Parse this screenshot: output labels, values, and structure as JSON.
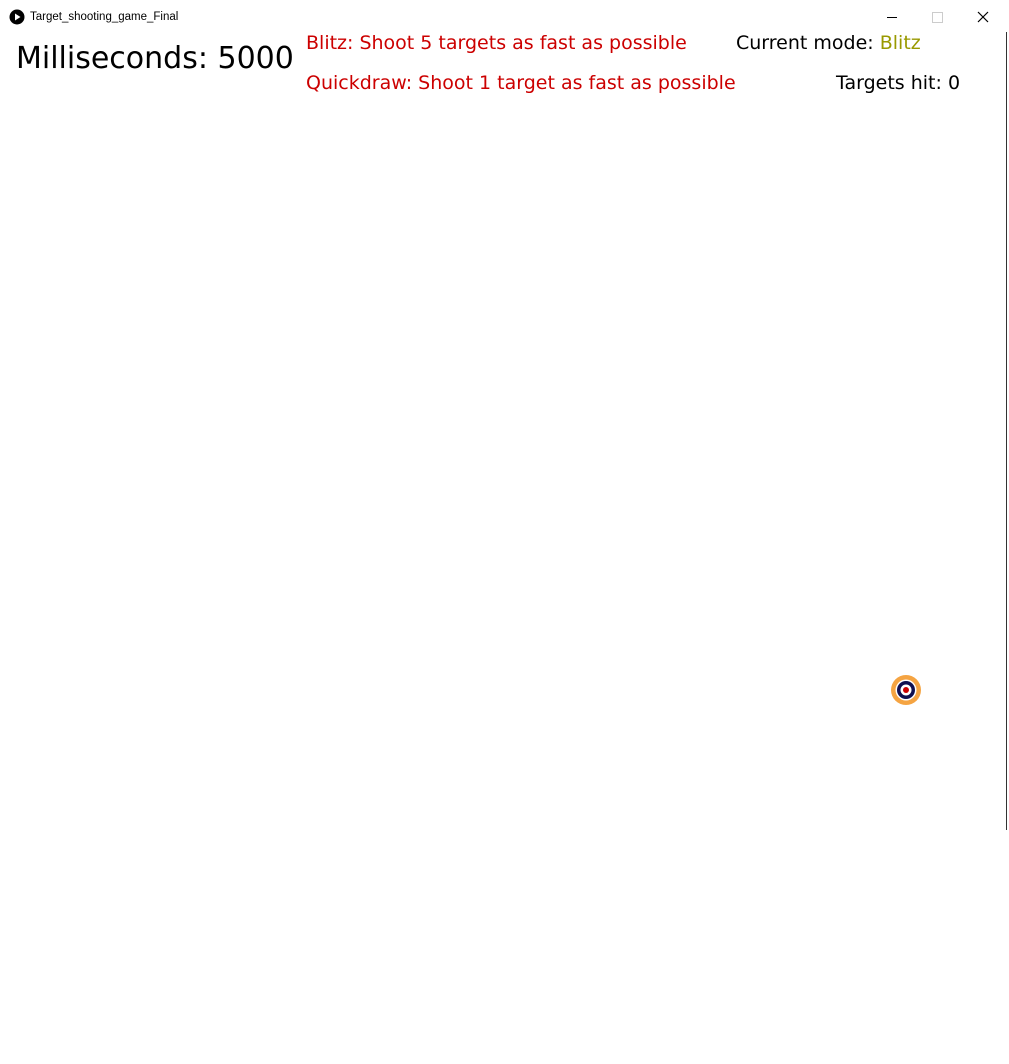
{
  "window": {
    "title": "Target_shooting_game_Final",
    "app_icon": "play-icon",
    "controls": {
      "minimize_icon": "minimize-icon",
      "maximize_icon": "maximize-icon",
      "close_icon": "close-icon"
    }
  },
  "hud": {
    "timer_label": "Milliseconds:",
    "timer_value": "5000",
    "blitz_description": "Blitz: Shoot 5 targets as fast as possible",
    "quickdraw_description": "Quickdraw: Shoot 1 target as fast as possible",
    "mode_label": "Current mode:",
    "mode_value": "Blitz",
    "hits_label": "Targets hit:",
    "hits_value": "0"
  },
  "target": {
    "icon": "target-icon",
    "ring_colors": [
      "#f5a442",
      "#ffffff",
      "#101050",
      "#ffffff",
      "#cc0000"
    ]
  },
  "colors": {
    "mode_description": "#cc0000",
    "mode_highlight": "#999900",
    "text": "#000000"
  }
}
